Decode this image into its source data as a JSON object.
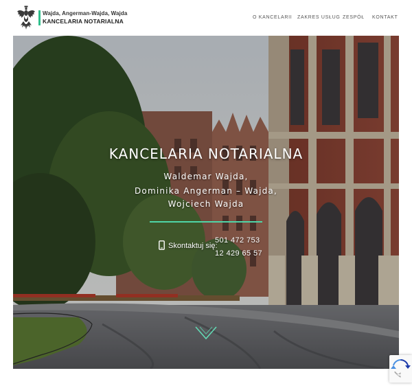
{
  "brand": {
    "subtitle": "Wajda, Angerman-Wajda, Wajda",
    "title": "KANCELARIA NOTARIALNA"
  },
  "nav": [
    {
      "label": "O KANCELARII"
    },
    {
      "label": "ZAKRES USŁUG"
    },
    {
      "label": "ZESPÓŁ"
    },
    {
      "label": "KONTAKT"
    }
  ],
  "hero": {
    "title": "KANCELARIA NOTARIALNA",
    "names": [
      "Waldemar Wajda,",
      "Dominika Angerman – Wajda,",
      "Wojciech Wajda"
    ],
    "contact_label": "Skontaktuj się:",
    "phones": [
      "501 472 753",
      "12 429 65 57"
    ]
  },
  "icons": {
    "logo": "eagle-emblem-icon",
    "phone": "mobile-phone-icon",
    "scroll": "chevron-down-icon",
    "recaptcha": "recaptcha-icon"
  },
  "colors": {
    "accent": "#2fbf8c",
    "divider": "#4fd6a8",
    "text_dark": "#222222"
  }
}
